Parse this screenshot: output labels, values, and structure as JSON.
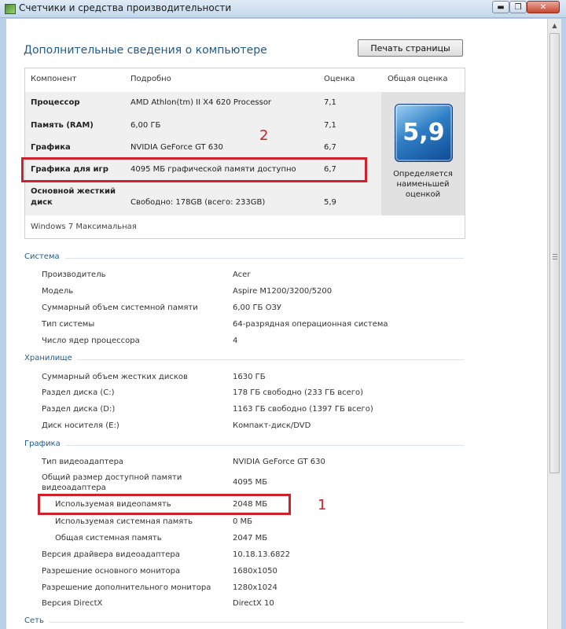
{
  "window": {
    "title": "Счетчики и средства производительности",
    "controls": {
      "minimize": "▬",
      "maximize": "❐",
      "close": "✕"
    }
  },
  "page": {
    "heading": "Дополнительные сведения о компьютере",
    "print_button": "Печать страницы"
  },
  "rating": {
    "headers": {
      "component": "Компонент",
      "details": "Подробно",
      "score": "Оценка",
      "overall": "Общая оценка"
    },
    "rows": [
      {
        "component": "Процессор",
        "details": "AMD Athlon(tm) II X4 620 Processor",
        "score": "7,1"
      },
      {
        "component": "Память (RAM)",
        "details": "6,00 ГБ",
        "score": "7,1"
      },
      {
        "component": "Графика",
        "details": "NVIDIA GeForce GT 630",
        "score": "6,7"
      },
      {
        "component": "Графика для игр",
        "details": "4095 МБ графической памяти доступно",
        "score": "6,7"
      },
      {
        "component_line1": "Основной жесткий",
        "component_line2": "диск",
        "details": "Свободно: 178GB (всего: 233GB)",
        "score": "5,9"
      }
    ],
    "overall_score": "5,9",
    "overall_caption": [
      "Определяется",
      "наименьшей",
      "оценкой"
    ],
    "edition": "Windows 7 Максимальная"
  },
  "annotations": {
    "one": "1",
    "two": "2",
    "color": "#d0202c"
  },
  "system": {
    "title": "Система",
    "items": [
      {
        "label": "Производитель",
        "value": "Acer"
      },
      {
        "label": "Модель",
        "value": "Aspire M1200/3200/5200"
      },
      {
        "label": "Суммарный объем системной памяти",
        "value": "6,00 ГБ ОЗУ"
      },
      {
        "label": "Тип системы",
        "value": "64-разрядная операционная система"
      },
      {
        "label": "Число ядер процессора",
        "value": "4"
      }
    ]
  },
  "storage": {
    "title": "Хранилище",
    "items": [
      {
        "label": "Суммарный объем жестких дисков",
        "value": "1630 ГБ"
      },
      {
        "label": "Раздел диска (C:)",
        "value": "178 ГБ свободно (233 ГБ всего)"
      },
      {
        "label": "Раздел диска (D:)",
        "value": "1163 ГБ свободно (1397 ГБ всего)"
      },
      {
        "label": "Диск носителя (E:)",
        "value": "Компакт-диск/DVD"
      }
    ]
  },
  "graphics": {
    "title": "Графика",
    "items": [
      {
        "label": "Тип видеоадаптера",
        "value": "NVIDIA GeForce GT 630"
      },
      {
        "label_line1": "Общий размер доступной памяти",
        "label_line2": "видеоадаптера",
        "value": "4095 МБ"
      },
      {
        "label": "Используемая видеопамять",
        "value": "2048 МБ"
      },
      {
        "label": "Используемая системная память",
        "value": "0 МБ"
      },
      {
        "label": "Общая системная память",
        "value": "2047 МБ"
      },
      {
        "label": "Версия драйвера видеоадаптера",
        "value": "10.18.13.6822"
      },
      {
        "label": "Разрешение основного монитора",
        "value": "1680x1050"
      },
      {
        "label": "Разрешение дополнительного монитора",
        "value": "1280x1024"
      },
      {
        "label": "Версия DirectX",
        "value": "DirectX 10"
      }
    ]
  },
  "network": {
    "title": "Сеть"
  }
}
